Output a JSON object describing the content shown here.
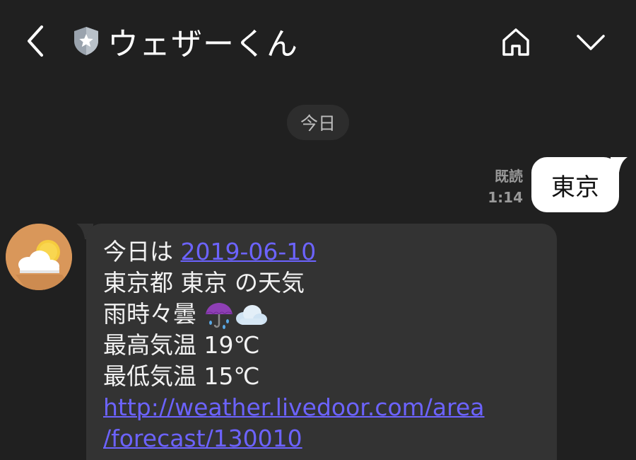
{
  "header": {
    "title": "ウェザーくん"
  },
  "chat": {
    "date_separator": "今日",
    "outgoing": {
      "read_status": "既読",
      "time": "1:14",
      "text": "東京"
    },
    "incoming": {
      "line1_prefix": "今日は ",
      "date_link": "2019-06-10",
      "line2": "東京都 東京 の天気",
      "line3": "雨時々曇 ",
      "line4": "最高気温 19℃",
      "line5": "最低気温 15℃",
      "url_part1": "http://weather.livedoor.com/area",
      "url_part2": "/forecast/130010"
    }
  },
  "colors": {
    "background": "#202020",
    "incoming_bubble": "#333333",
    "outgoing_bubble": "#ffffff",
    "link": "#6c63ff",
    "avatar_bg": "#d9975a"
  },
  "icons": [
    "back-arrow-icon",
    "shield-star-icon",
    "home-icon",
    "chevron-down-icon",
    "umbrella-icon",
    "cloud-icon",
    "sun-cloud-icon"
  ]
}
